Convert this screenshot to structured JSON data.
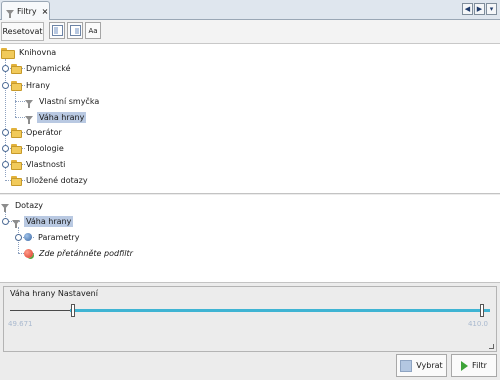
{
  "tab": {
    "label": "Filtry",
    "close": "×"
  },
  "nav": {
    "left": "◀",
    "right": "▶",
    "menu": "▾"
  },
  "toolbar": {
    "reset_label": "Resetovat",
    "font_button": "Aa"
  },
  "library": {
    "root": "Knihovna",
    "items": [
      {
        "label": "Dynamické"
      },
      {
        "label": "Hrany"
      },
      {
        "label": "Vlastní smyčka"
      },
      {
        "label": "Váha hrany"
      },
      {
        "label": "Operátor"
      },
      {
        "label": "Topologie"
      },
      {
        "label": "Vlastnosti"
      },
      {
        "label": "Uložené dotazy"
      }
    ]
  },
  "queries": {
    "root": "Dotazy",
    "filter": "Váha hrany",
    "params": "Parametry",
    "drop_hint": "Zde přetáhněte podfiltr"
  },
  "settings": {
    "title": "Váha hrany Nastavení",
    "min": "49.671",
    "max": "410.0",
    "range_low_fraction": 0.13,
    "range_high_fraction": 0.98
  },
  "buttons": {
    "select": "Vybrat",
    "filter": "Filtr"
  },
  "colors": {
    "accent": "#3fb4d3",
    "selection": "#b9c9e2",
    "folder": "#f1ca5b"
  }
}
